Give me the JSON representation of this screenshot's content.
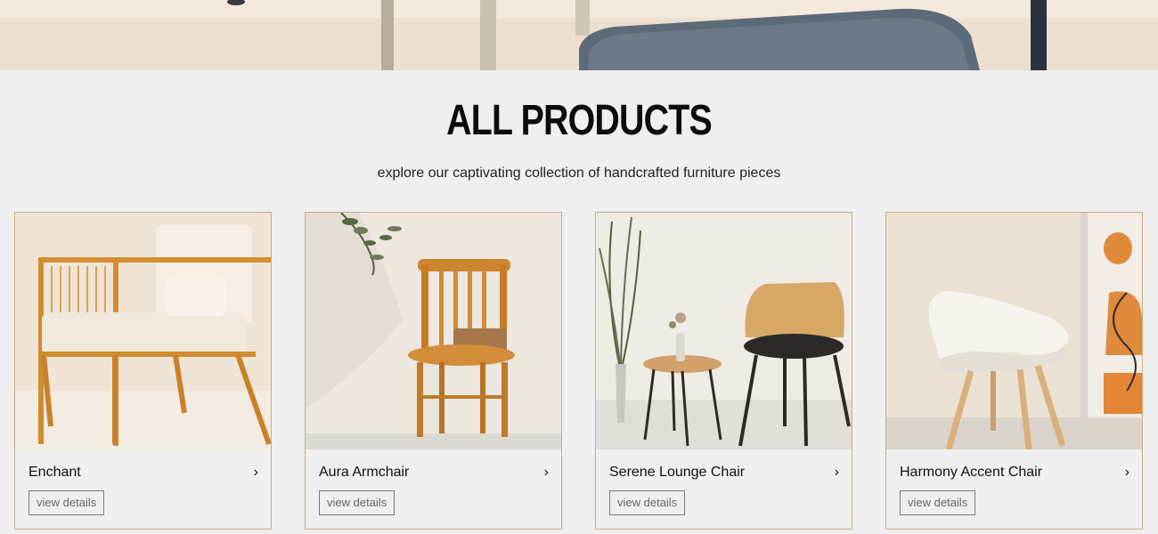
{
  "section": {
    "title": "ALL PRODUCTS",
    "subtitle": "explore our captivating collection of handcrafted furniture pieces"
  },
  "products": [
    {
      "name": "Enchant",
      "chevron": "›",
      "button": "view details",
      "icon": "armchair-photo"
    },
    {
      "name": "Aura Armchair",
      "chevron": "›",
      "button": "view details",
      "icon": "wooden-chair-photo"
    },
    {
      "name": "Serene Lounge Chair",
      "chevron": "›",
      "button": "view details",
      "icon": "lounge-chair-photo"
    },
    {
      "name": "Harmony Accent Chair",
      "chevron": "›",
      "button": "view details",
      "icon": "accent-chair-photo"
    }
  ],
  "colors": {
    "background": "#efefef",
    "card_border": "#c9ad86",
    "button_border": "#7a7a7a"
  }
}
